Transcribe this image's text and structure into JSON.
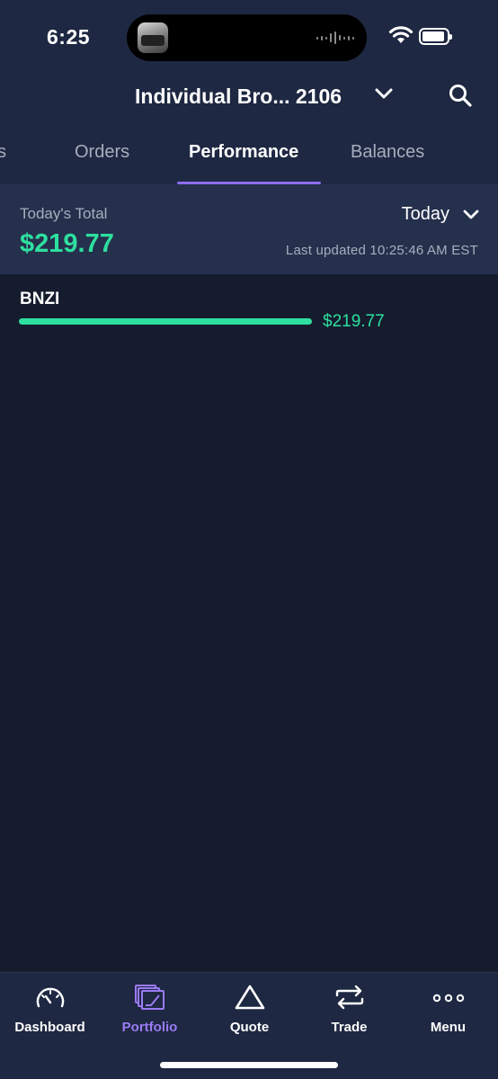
{
  "status_bar": {
    "time": "6:25",
    "icons": [
      "now-playing-thumbnail",
      "audio-wave-icon",
      "wifi-icon",
      "battery-icon"
    ]
  },
  "header": {
    "account_title": "Individual Bro... 2106",
    "icons": [
      "chevron-down-icon",
      "search-icon"
    ]
  },
  "tabs": [
    {
      "label": "s",
      "active": false
    },
    {
      "label": "Orders",
      "active": false
    },
    {
      "label": "Performance",
      "active": true
    },
    {
      "label": "Balances",
      "active": false
    }
  ],
  "summary": {
    "label": "Today's Total",
    "total": "$219.77",
    "period": "Today",
    "last_updated": "Last updated 10:25:46 AM EST"
  },
  "holdings": [
    {
      "symbol": "BNZI",
      "value": "$219.77",
      "bar_fraction": 1.0
    }
  ],
  "bottom_nav": [
    {
      "label": "Dashboard",
      "icon": "gauge-icon",
      "active": false
    },
    {
      "label": "Portfolio",
      "icon": "portfolio-icon",
      "active": true
    },
    {
      "label": "Quote",
      "icon": "triangle-icon",
      "active": false
    },
    {
      "label": "Trade",
      "icon": "swap-arrows-icon",
      "active": false
    },
    {
      "label": "Menu",
      "icon": "more-dots-icon",
      "active": false
    }
  ],
  "colors": {
    "background": "#151c2e",
    "header_bg": "#1e2842",
    "summary_bg": "#25304d",
    "positive": "#2ee09f",
    "accent": "#8e6cf6",
    "muted_text": "#a7aebd"
  }
}
